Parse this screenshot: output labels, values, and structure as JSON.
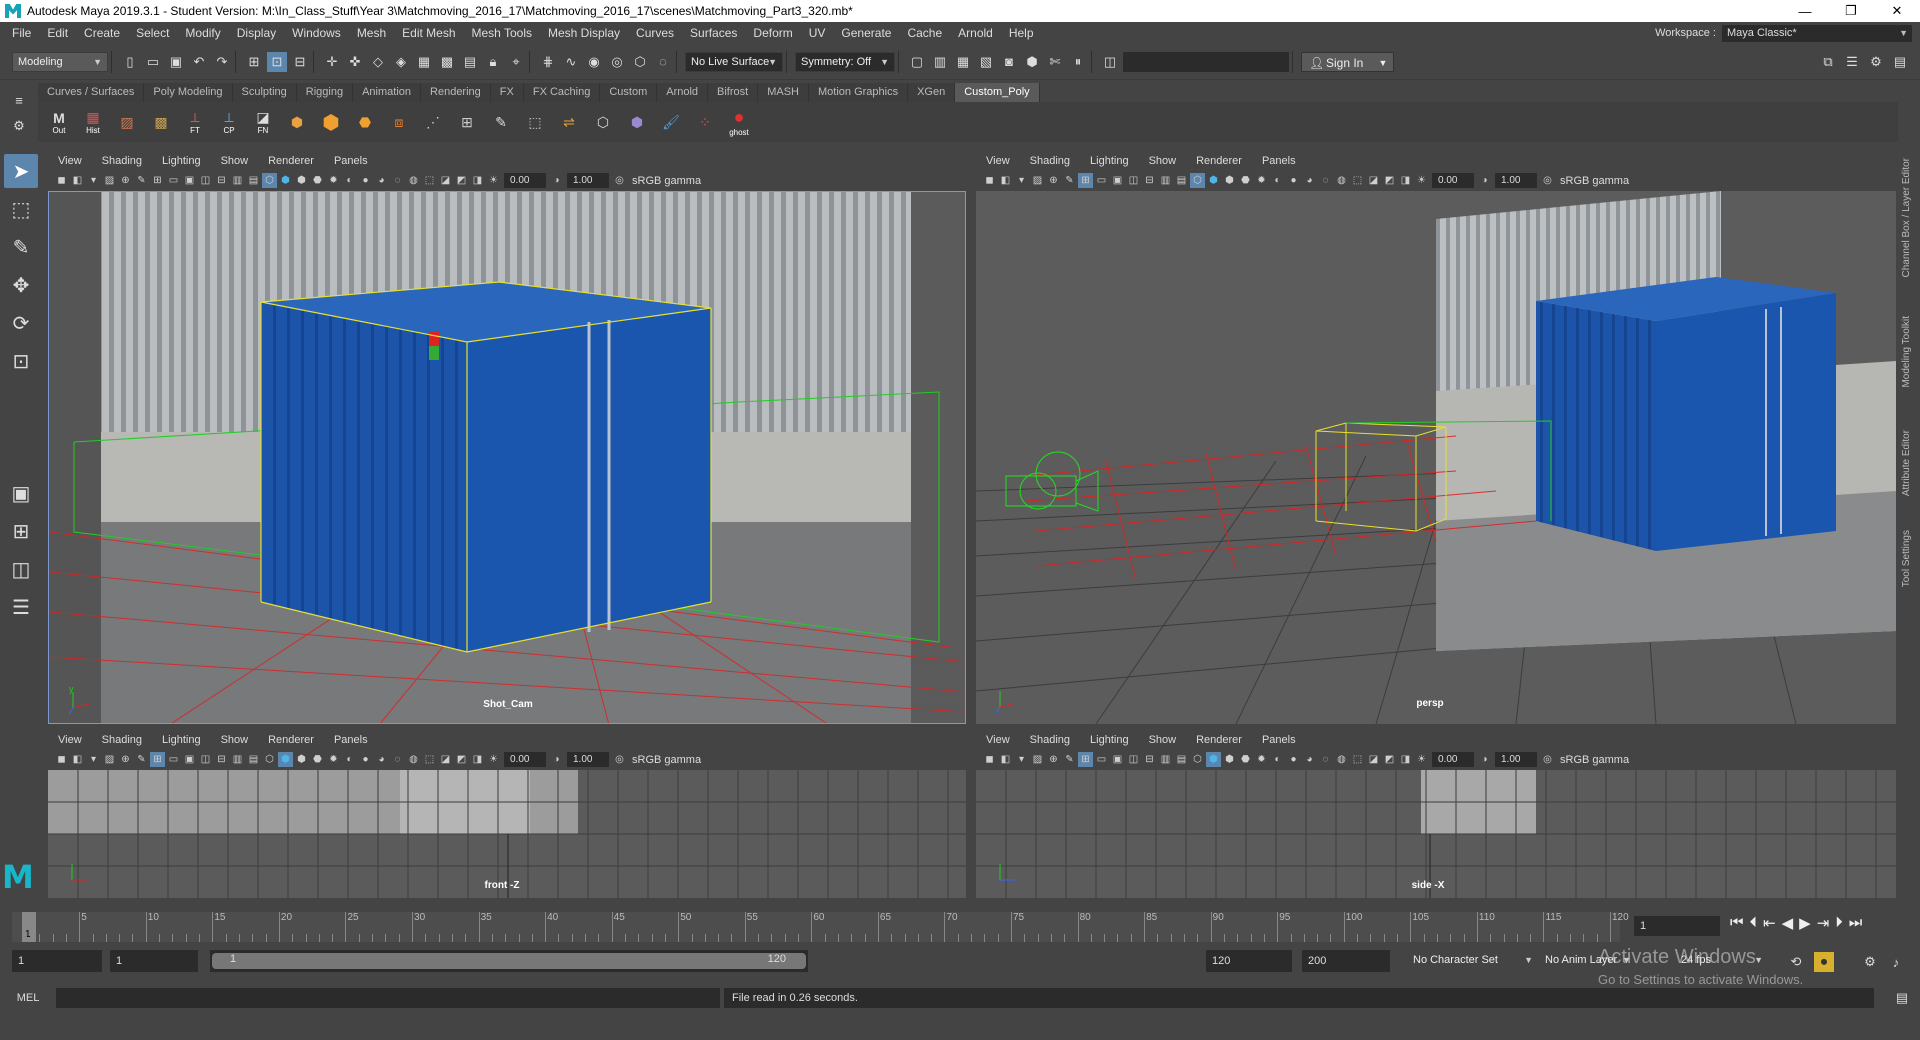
{
  "window": {
    "title": "Autodesk Maya 2019.3.1 - Student Version: M:\\In_Class_Stuff\\Year 3\\Matchmoving_2016_17\\Matchmoving_2016_17\\scenes\\Matchmoving_Part3_320.mb*",
    "min": "—",
    "max": "❐",
    "close": "✕"
  },
  "menu": [
    "File",
    "Edit",
    "Create",
    "Select",
    "Modify",
    "Display",
    "Windows",
    "Mesh",
    "Edit Mesh",
    "Mesh Tools",
    "Mesh Display",
    "Curves",
    "Surfaces",
    "Deform",
    "UV",
    "Generate",
    "Cache",
    "Arnold",
    "Help"
  ],
  "workspace": {
    "label": "Workspace :",
    "value": "Maya Classic*"
  },
  "status": {
    "menu_set": "Modeling",
    "live_surface": "No Live Surface",
    "symmetry": "Symmetry: Off",
    "sign_in": "Sign In"
  },
  "shelf_tabs": [
    "Curves / Surfaces",
    "Poly Modeling",
    "Sculpting",
    "Rigging",
    "Animation",
    "Rendering",
    "FX",
    "FX Caching",
    "Custom",
    "Arnold",
    "Bifrost",
    "MASH",
    "Motion Graphics",
    "XGen",
    "Custom_Poly"
  ],
  "shelf_active": "Custom_Poly",
  "shelf_icons": [
    {
      "name": "out-icon",
      "label": "Out"
    },
    {
      "name": "hist-icon",
      "label": "Hist"
    },
    {
      "name": "grid-icon",
      "label": ""
    },
    {
      "name": "checker-icon",
      "label": ""
    },
    {
      "name": "ft-icon",
      "label": "FT"
    },
    {
      "name": "cp-icon",
      "label": "CP"
    },
    {
      "name": "fn-icon",
      "label": "FN"
    },
    {
      "name": "cube-split-icon",
      "label": ""
    },
    {
      "name": "cube-icon",
      "label": ""
    },
    {
      "name": "cube-bevel-icon",
      "label": ""
    },
    {
      "name": "cubes-icon",
      "label": ""
    },
    {
      "name": "vertex-icon",
      "label": ""
    },
    {
      "name": "edge-loop-icon",
      "label": ""
    },
    {
      "name": "pen-icon",
      "label": ""
    },
    {
      "name": "extrude-icon",
      "label": ""
    },
    {
      "name": "bridge-icon",
      "label": ""
    },
    {
      "name": "cube-outline-icon",
      "label": ""
    },
    {
      "name": "wire-cube-icon",
      "label": ""
    },
    {
      "name": "brush-icon",
      "label": ""
    },
    {
      "name": "dots-icon",
      "label": ""
    },
    {
      "name": "ghost-icon",
      "label": "ghost"
    }
  ],
  "viewport_menu": [
    "View",
    "Shading",
    "Lighting",
    "Show",
    "Renderer",
    "Panels"
  ],
  "viewport_values": {
    "exposure": "0.00",
    "gamma": "1.00",
    "color_space": "sRGB gamma"
  },
  "panels": {
    "tl": {
      "label": "Shot_Cam"
    },
    "tr": {
      "label": "persp"
    },
    "bl": {
      "label": "front -Z"
    },
    "br": {
      "label": "side -X"
    }
  },
  "right_tabs": [
    "Channel Box / Layer Editor",
    "Modeling Toolkit",
    "Attribute Editor",
    "Tool Settings"
  ],
  "timeline": {
    "ticks": [
      "5",
      "10",
      "15",
      "20",
      "25",
      "30",
      "35",
      "40",
      "45",
      "50",
      "55",
      "60",
      "65",
      "70",
      "75",
      "80",
      "85",
      "90",
      "95",
      "100",
      "105",
      "110",
      "115",
      "120"
    ],
    "current": "1",
    "frame_field": "1"
  },
  "range": {
    "start": "1",
    "playback_start": "1",
    "slider_left": "1",
    "slider_right": "120",
    "playback_end": "120",
    "end": "200",
    "character_set": "No Character Set",
    "anim_layer": "No Anim Layer",
    "fps": "24 fps"
  },
  "cmd": {
    "lang": "MEL",
    "result": "File read in  0.26 seconds."
  },
  "watermark": {
    "title": "Activate Windows",
    "sub": "Go to Settings to activate Windows."
  }
}
